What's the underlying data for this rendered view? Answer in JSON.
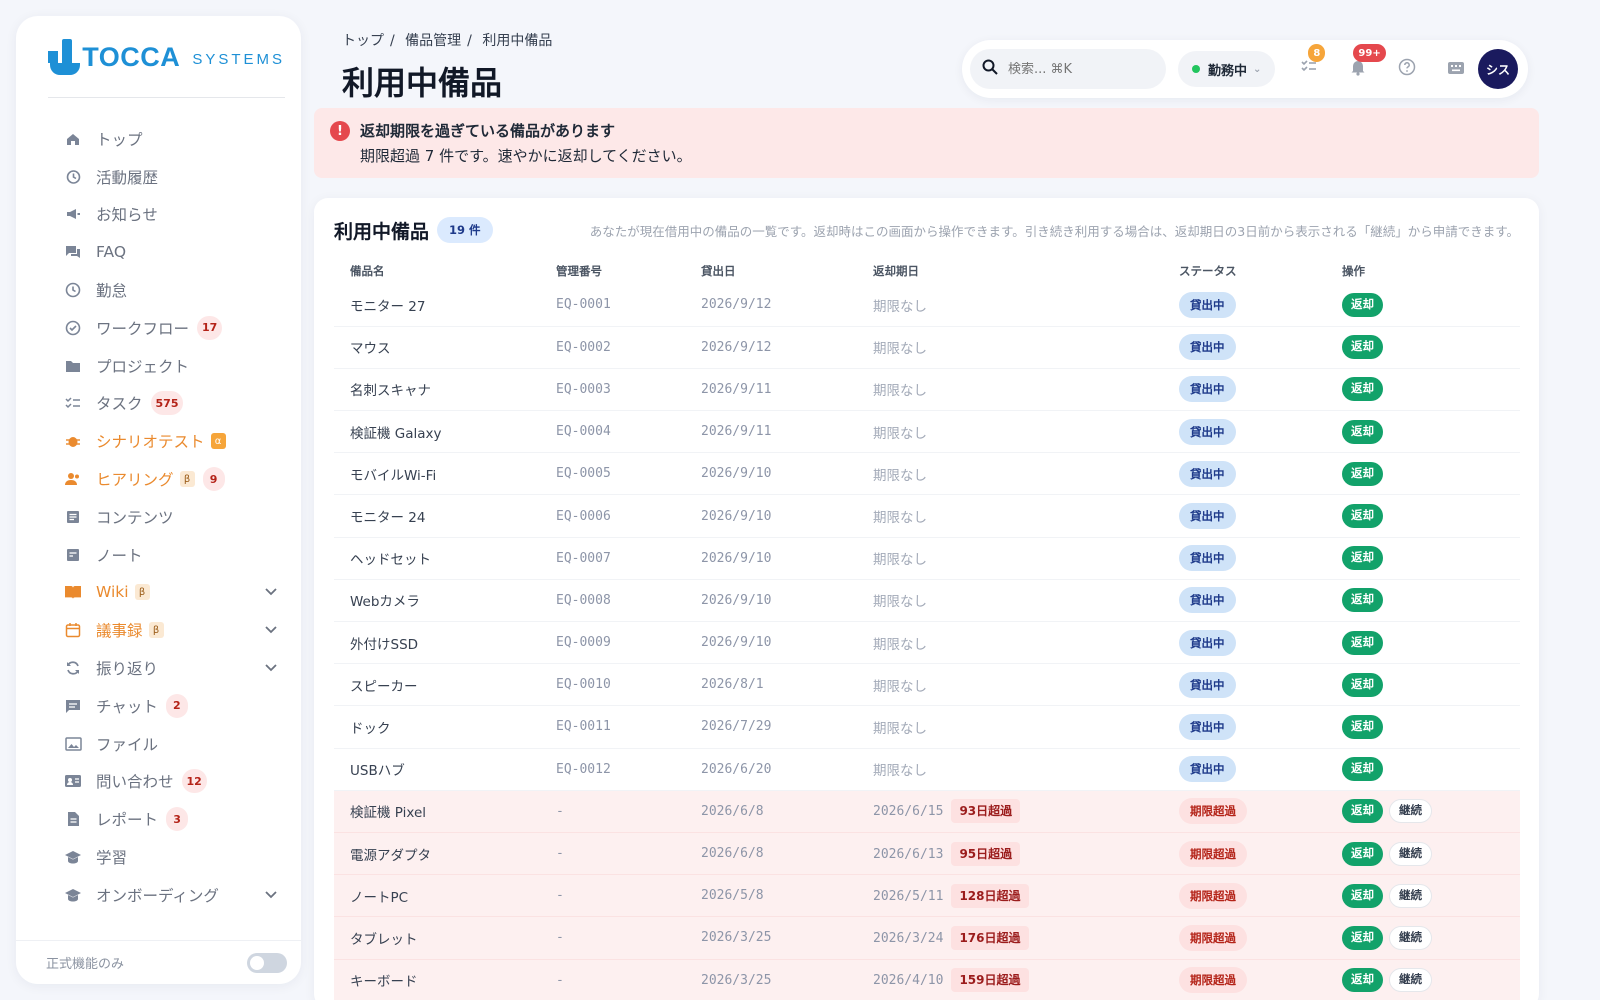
{
  "app": {
    "logo_main": "TOCCA",
    "logo_sub": "SYSTEMS"
  },
  "sidebar": {
    "items": [
      {
        "label": "トップ",
        "icon": "home-icon"
      },
      {
        "label": "活動履歴",
        "icon": "history-icon"
      },
      {
        "label": "お知らせ",
        "icon": "megaphone-icon"
      },
      {
        "label": "FAQ",
        "icon": "forum-icon"
      },
      {
        "label": "勤怠",
        "icon": "clock-icon"
      },
      {
        "label": "ワークフロー",
        "icon": "check-circle-icon",
        "badge": "17"
      },
      {
        "label": "プロジェクト",
        "icon": "folder-icon"
      },
      {
        "label": "タスク",
        "icon": "checklist-icon",
        "badge": "575"
      },
      {
        "label": "シナリオテスト",
        "icon": "bug-icon",
        "tag": "α"
      },
      {
        "label": "ヒアリング",
        "icon": "people-icon",
        "tag": "β",
        "badge": "9"
      },
      {
        "label": "コンテンツ",
        "icon": "article-icon"
      },
      {
        "label": "ノート",
        "icon": "note-icon"
      },
      {
        "label": "Wiki",
        "icon": "book-icon",
        "tag": "β"
      },
      {
        "label": "議事録",
        "icon": "calendar-icon",
        "tag": "β"
      },
      {
        "label": "振り返り",
        "icon": "refresh-icon"
      },
      {
        "label": "チャット",
        "icon": "chat-icon",
        "badge": "2"
      },
      {
        "label": "ファイル",
        "icon": "image-icon"
      },
      {
        "label": "問い合わせ",
        "icon": "contact-card-icon",
        "badge": "12"
      },
      {
        "label": "レポート",
        "icon": "document-icon",
        "badge": "3"
      },
      {
        "label": "学習",
        "icon": "school-icon"
      },
      {
        "label": "オンボーディング",
        "icon": "school-icon"
      }
    ],
    "footer_label": "正式機能のみ"
  },
  "breadcrumb": [
    "トップ",
    "備品管理",
    "利用中備品"
  ],
  "page_title": "利用中備品",
  "toolbar": {
    "search_placeholder": "検索... ⌘K",
    "status": "勤務中",
    "tasks_badge": "8",
    "notif_badge": "99+",
    "avatar": "シス"
  },
  "alert": {
    "title": "返却期限を過ぎている備品があります",
    "message": "期限超過 7 件です。速やかに返却してください。"
  },
  "card": {
    "title": "利用中備品",
    "count": "19 件",
    "description": "あなたが現在借用中の備品の一覧です。返却時はこの画面から操作できます。引き続き利用する場合は、返却期日の3日前から表示される「継続」から申請できます。",
    "columns": [
      "備品名",
      "管理番号",
      "貸出日",
      "返却期日",
      "ステータス",
      "操作"
    ],
    "return_label": "返却",
    "continue_label": "継続",
    "rows": [
      {
        "name": "モニター 27",
        "code": "EQ-0001",
        "lent": "2026/9/12",
        "due": "期限なし",
        "status": "貸出中"
      },
      {
        "name": "マウス",
        "code": "EQ-0002",
        "lent": "2026/9/12",
        "due": "期限なし",
        "status": "貸出中"
      },
      {
        "name": "名刺スキャナ",
        "code": "EQ-0003",
        "lent": "2026/9/11",
        "due": "期限なし",
        "status": "貸出中"
      },
      {
        "name": "検証機 Galaxy",
        "code": "EQ-0004",
        "lent": "2026/9/11",
        "due": "期限なし",
        "status": "貸出中"
      },
      {
        "name": "モバイルWi-Fi",
        "code": "EQ-0005",
        "lent": "2026/9/10",
        "due": "期限なし",
        "status": "貸出中"
      },
      {
        "name": "モニター 24",
        "code": "EQ-0006",
        "lent": "2026/9/10",
        "due": "期限なし",
        "status": "貸出中"
      },
      {
        "name": "ヘッドセット",
        "code": "EQ-0007",
        "lent": "2026/9/10",
        "due": "期限なし",
        "status": "貸出中"
      },
      {
        "name": "Webカメラ",
        "code": "EQ-0008",
        "lent": "2026/9/10",
        "due": "期限なし",
        "status": "貸出中"
      },
      {
        "name": "外付けSSD",
        "code": "EQ-0009",
        "lent": "2026/9/10",
        "due": "期限なし",
        "status": "貸出中"
      },
      {
        "name": "スピーカー",
        "code": "EQ-0010",
        "lent": "2026/8/1",
        "due": "期限なし",
        "status": "貸出中"
      },
      {
        "name": "ドック",
        "code": "EQ-0011",
        "lent": "2026/7/29",
        "due": "期限なし",
        "status": "貸出中"
      },
      {
        "name": "USBハブ",
        "code": "EQ-0012",
        "lent": "2026/6/20",
        "due": "期限なし",
        "status": "貸出中"
      },
      {
        "name": "検証機 Pixel",
        "code": "-",
        "lent": "2026/6/8",
        "due": "2026/6/15",
        "overdue": "93日超過",
        "status": "期限超過"
      },
      {
        "name": "電源アダプタ",
        "code": "-",
        "lent": "2026/6/8",
        "due": "2026/6/13",
        "overdue": "95日超過",
        "status": "期限超過"
      },
      {
        "name": "ノートPC",
        "code": "-",
        "lent": "2026/5/8",
        "due": "2026/5/11",
        "overdue": "128日超過",
        "status": "期限超過"
      },
      {
        "name": "タブレット",
        "code": "-",
        "lent": "2026/3/25",
        "due": "2026/3/24",
        "overdue": "176日超過",
        "status": "期限超過"
      },
      {
        "name": "キーボード",
        "code": "-",
        "lent": "2026/3/25",
        "due": "2026/4/10",
        "overdue": "159日超過",
        "status": "期限超過"
      }
    ]
  },
  "colors": {
    "brand": "#1e90d6",
    "success": "#12a26a",
    "danger": "#e5484d",
    "warning": "#ea8a2e"
  }
}
